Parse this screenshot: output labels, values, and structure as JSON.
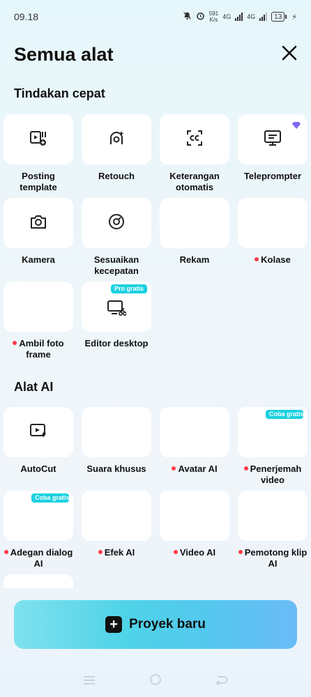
{
  "status_bar": {
    "time": "09.18",
    "net_speed": "591",
    "net_unit": "K/s",
    "net1": "4G",
    "net2": "4G",
    "battery": "13"
  },
  "header": {
    "title": "Semua alat",
    "close_icon": "close-icon"
  },
  "quick_actions": {
    "title": "Tindakan cepat",
    "items": [
      {
        "label": "Posting template",
        "icon": "post-template-icon"
      },
      {
        "label": "Retouch",
        "icon": "retouch-icon"
      },
      {
        "label": "Keterangan otomatis",
        "icon": "auto-caption-icon"
      },
      {
        "label": "Teleprompter",
        "icon": "teleprompter-icon",
        "extra": "gem-icon"
      },
      {
        "label": "Kamera",
        "icon": "camera-icon"
      },
      {
        "label": "Sesuaikan kecepatan",
        "icon": "speed-icon"
      },
      {
        "label": "Rekam"
      },
      {
        "label": "Kolase",
        "dot": true
      },
      {
        "label": "Ambil foto frame",
        "dot": true
      },
      {
        "label": "Editor desktop",
        "icon": "desktop-editor-icon",
        "badge": "Pro gratis"
      }
    ]
  },
  "ai_tools": {
    "title": "Alat AI",
    "items": [
      {
        "label": "AutoCut",
        "icon": "autocut-icon"
      },
      {
        "label": "Suara khusus"
      },
      {
        "label": "Avatar AI",
        "dot": true
      },
      {
        "label": "Penerjemah video",
        "dot": true,
        "badge": "Coba gratis"
      },
      {
        "label": "Adegan dialog AI",
        "dot": true,
        "badge": "Coba gratis"
      },
      {
        "label": "Efek AI",
        "dot": true
      },
      {
        "label": "Video AI",
        "dot": true
      },
      {
        "label": "Pemotong klip AI",
        "dot": true
      }
    ]
  },
  "new_project": {
    "label": "Proyek baru"
  },
  "nav": {
    "menu_icon": "menu-icon",
    "home_icon": "home-icon",
    "back_icon": "back-icon"
  },
  "colors": {
    "accent": "#1ad1e0",
    "dot": "#ff3b4a",
    "button_gradient_start": "#7fe1ee",
    "button_gradient_end": "#6bbcf7"
  }
}
